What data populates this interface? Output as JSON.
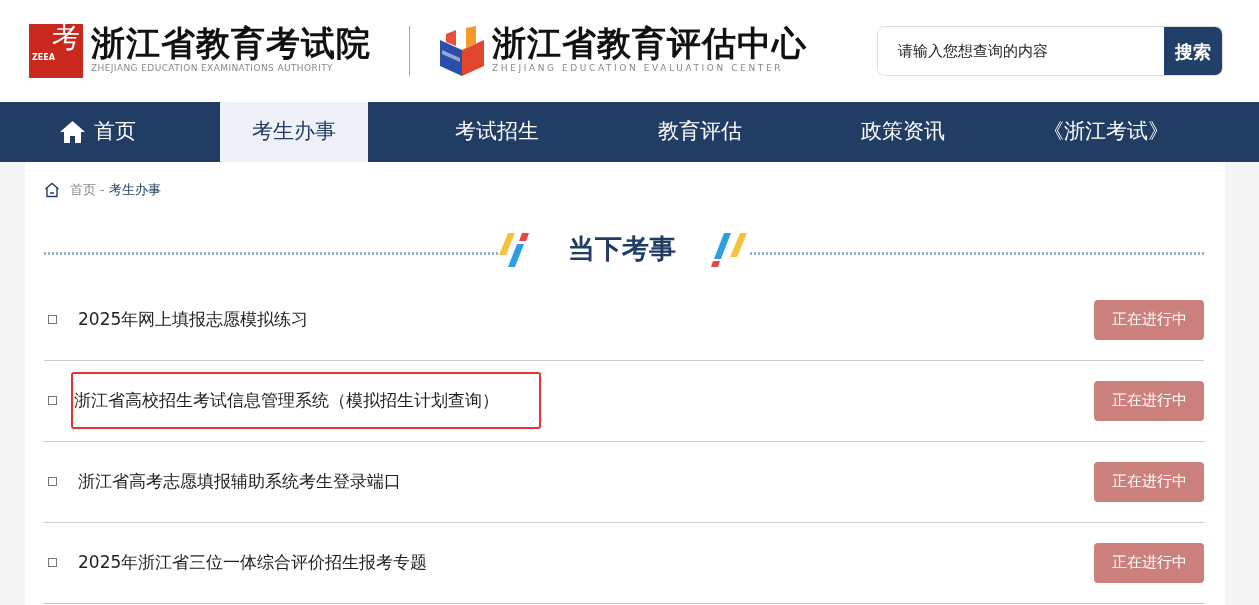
{
  "header": {
    "logo_left": {
      "mark": "考",
      "abbr": "ZEEA",
      "title": "浙江省教育考试院",
      "subtitle": "ZHEJIANG EDUCATION EXAMINATIONS AUTHORITY"
    },
    "logo_right": {
      "title": "浙江省教育评估中心",
      "subtitle": "ZHEJIANG EDUCATION EVALUATION CENTER"
    },
    "search": {
      "placeholder": "请输入您想查询的内容",
      "button": "搜索"
    }
  },
  "nav": [
    {
      "label": "首页",
      "selected": false
    },
    {
      "label": "考生办事",
      "selected": true
    },
    {
      "label": "考试招生",
      "selected": false
    },
    {
      "label": "教育评估",
      "selected": false
    },
    {
      "label": "政策资讯",
      "selected": false
    },
    {
      "label": "《浙江考试》",
      "selected": false
    }
  ],
  "breadcrumb": [
    {
      "label": "首页",
      "current": false
    },
    {
      "label": "考生办事",
      "current": true
    }
  ],
  "breadcrumb_separator": "-",
  "section_title": "当下考事",
  "items": [
    {
      "title": "2025年网上填报志愿模拟练习",
      "status": "正在进行中",
      "highlighted": false
    },
    {
      "title": "浙江省高校招生考试信息管理系统（模拟招生计划查询）",
      "status": "正在进行中",
      "highlighted": true
    },
    {
      "title": "浙江省高考志愿填报辅助系统考生登录端口",
      "status": "正在进行中",
      "highlighted": false
    },
    {
      "title": "2025年浙江省三位一体综合评价招生报考专题",
      "status": "正在进行中",
      "highlighted": false
    }
  ]
}
